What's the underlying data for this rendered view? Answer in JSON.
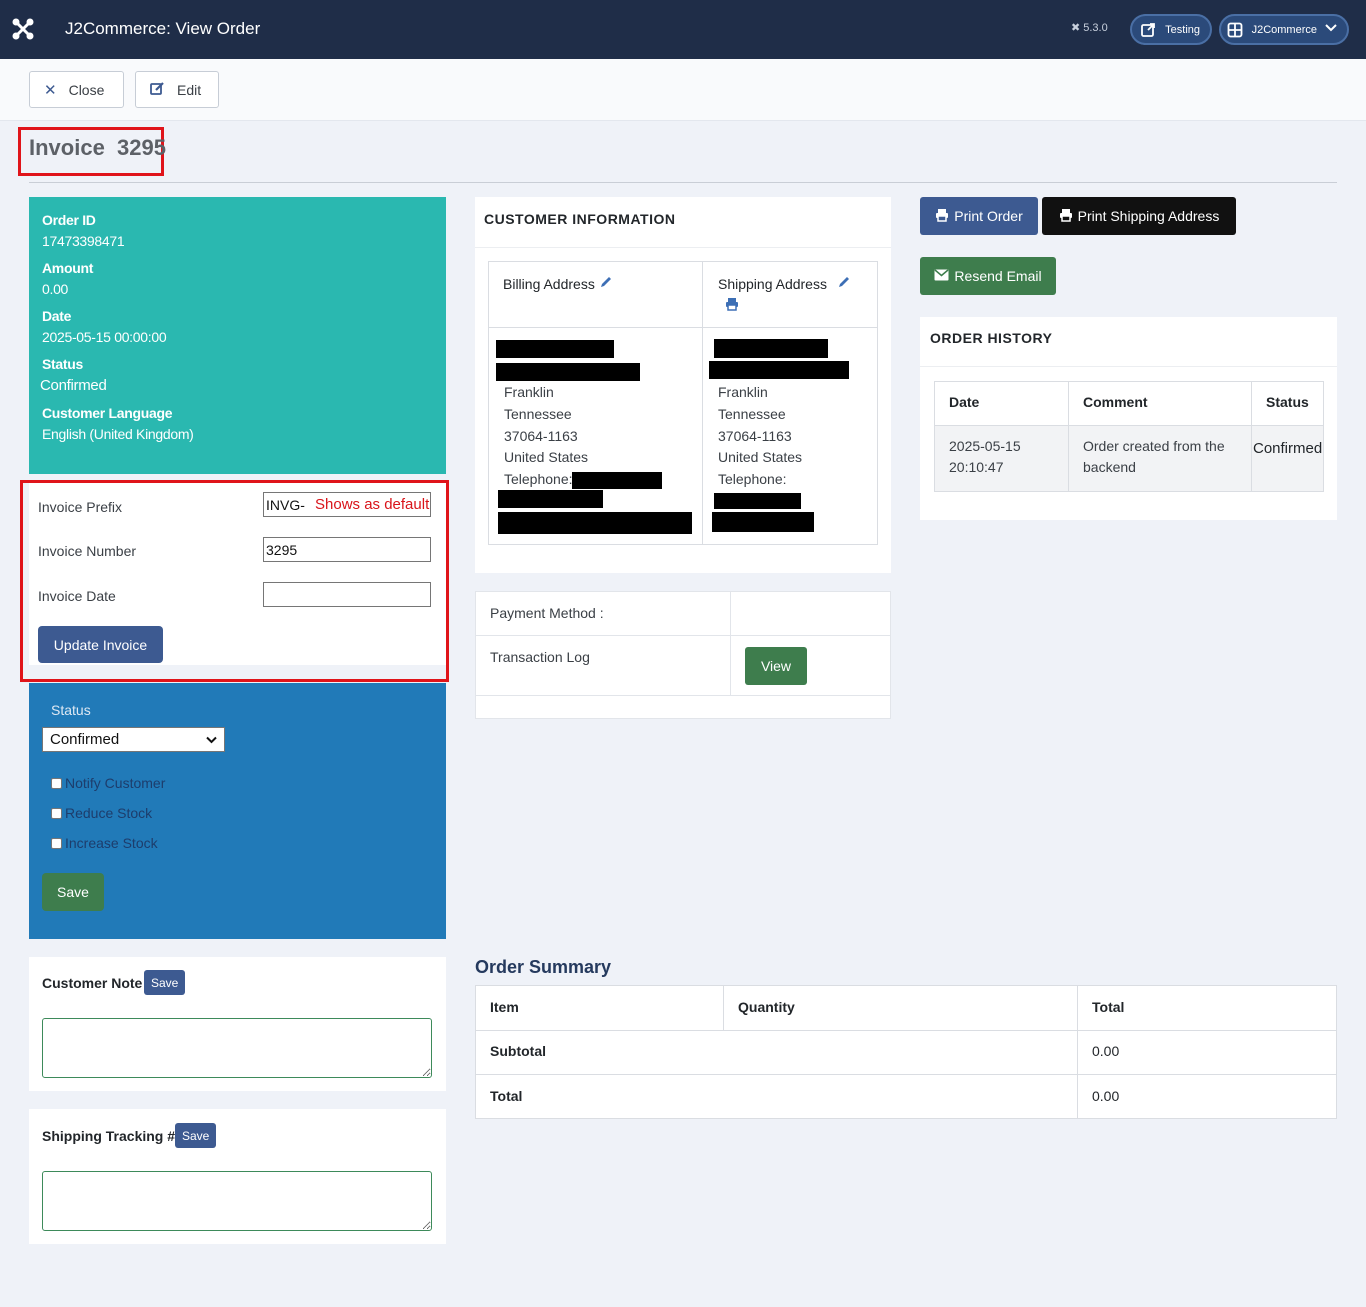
{
  "header": {
    "title": "J2Commerce: View Order",
    "version": "5.3.0",
    "site_link": "Testing",
    "user_menu": "J2Commerce"
  },
  "toolbar": {
    "close_label": "Close",
    "edit_label": "Edit"
  },
  "invoice_heading": "Invoice  3295",
  "order_info": {
    "order_id_label": "Order ID",
    "order_id": "17473398471",
    "amount_label": "Amount",
    "amount": "0.00",
    "date_label": "Date",
    "date": "2025-05-15 00:00:00",
    "status_label": "Status",
    "status": "Confirmed",
    "language_label": "Customer Language",
    "language": "English (United Kingdom)"
  },
  "invoice_form": {
    "prefix_label": "Invoice Prefix",
    "prefix_value": "INVG-",
    "prefix_note": "Shows as default",
    "number_label": "Invoice Number",
    "number_value": "3295",
    "date_label": "Invoice Date",
    "date_value": "",
    "update_label": "Update Invoice"
  },
  "status_form": {
    "label": "Status",
    "selected": "Confirmed",
    "notify": "Notify Customer",
    "reduce": "Reduce Stock",
    "increase": "Increase Stock",
    "save_label": "Save"
  },
  "customer_note": {
    "title": "Customer Note",
    "save_label": "Save"
  },
  "shipping_tracking": {
    "title": "Shipping Tracking #",
    "save_label": "Save"
  },
  "customer_info": {
    "title": "CUSTOMER INFORMATION",
    "billing_title": "Billing Address",
    "shipping_title": "Shipping Address",
    "billing": {
      "city": "Franklin",
      "state": "Tennessee",
      "zip": "37064-1163",
      "country": "United States",
      "phone_label": "Telephone:"
    },
    "shipping": {
      "city": "Franklin",
      "state": "Tennessee",
      "zip": "37064-1163",
      "country": "United States",
      "phone_label": "Telephone:"
    }
  },
  "payment": {
    "method_label": "Payment Method :",
    "log_label": "Transaction Log",
    "view_label": "View"
  },
  "actions": {
    "print_order": "Print Order",
    "print_shipping": "Print Shipping Address",
    "resend_email": "Resend Email"
  },
  "history": {
    "title": "ORDER HISTORY",
    "headers": [
      "Date",
      "Comment",
      "Status"
    ],
    "rows": [
      {
        "date": "2025-05-15 20:10:47",
        "date_line1": "2025-05-15",
        "date_line2": "20:10:47",
        "comment_line1": "Order created from the",
        "comment_line2": "backend",
        "status": "Confirmed"
      }
    ]
  },
  "summary": {
    "title": "Order Summary",
    "headers": [
      "Item",
      "Quantity",
      "Total"
    ],
    "subtotal_label": "Subtotal",
    "subtotal": "0.00",
    "total_label": "Total",
    "total": "0.00"
  },
  "colors": {
    "header": "#1f2d48",
    "teal": "#2ab8b0",
    "blue": "#217ab8",
    "primary": "#3d5a91",
    "success": "#3e7d4d",
    "highlight": "#e0141a"
  }
}
